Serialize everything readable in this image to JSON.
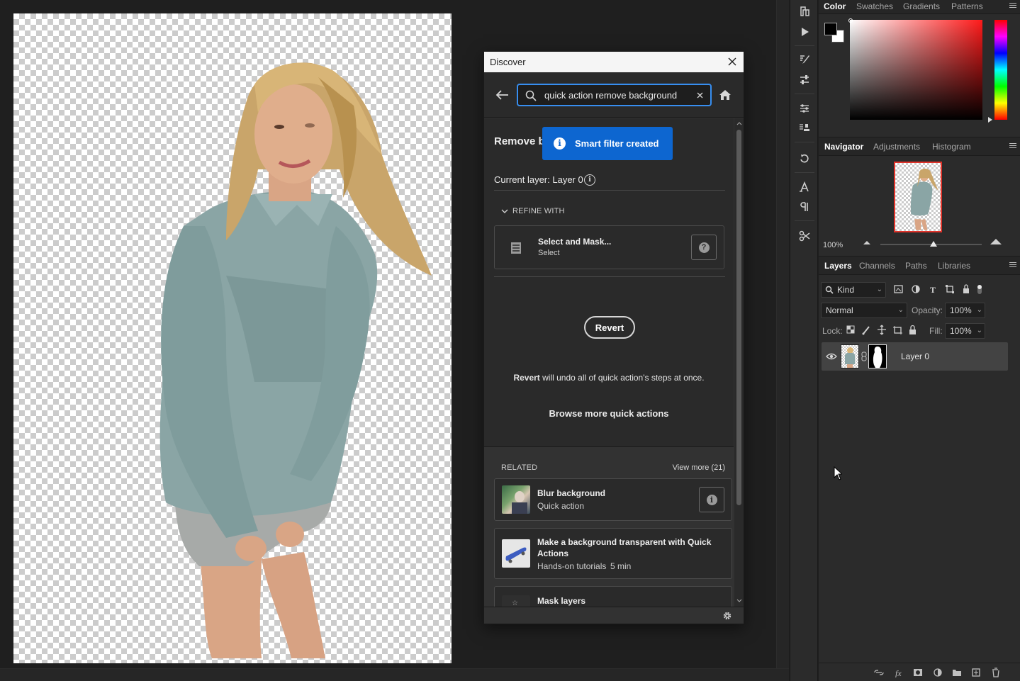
{
  "color_panel": {
    "tabs": [
      "Color",
      "Swatches",
      "Gradients",
      "Patterns"
    ],
    "foreground": "#000000",
    "background": "#ffffff"
  },
  "navigator": {
    "tabs": [
      "Navigator",
      "Adjustments",
      "Histogram"
    ],
    "zoom": "100%"
  },
  "layers": {
    "tabs": [
      "Layers",
      "Channels",
      "Paths",
      "Libraries"
    ],
    "filter_kind": "Kind",
    "blend_mode": "Normal",
    "opacity_label": "Opacity:",
    "opacity_value": "100%",
    "lock_label": "Lock:",
    "fill_label": "Fill:",
    "fill_value": "100%",
    "items": [
      {
        "name": "Layer 0",
        "visible": true
      }
    ]
  },
  "discover": {
    "title": "Discover",
    "search_value": "quick action remove background",
    "heading": "Remove b",
    "toast": "Smart filter created",
    "current_layer": "Current layer: Layer 0",
    "refine_heading": "REFINE WITH",
    "refine_item": {
      "title": "Select and Mask...",
      "subtitle": "Select"
    },
    "revert_label": "Revert",
    "revert_note_bold": "Revert",
    "revert_note_rest": " will undo all of quick action's steps at once.",
    "browse_more": "Browse more quick actions",
    "related_heading": "RELATED",
    "view_more": "View more (21)",
    "related": [
      {
        "title": "Blur background",
        "subtitle": "Quick action"
      },
      {
        "title": "Make a background transparent with Quick Actions",
        "subtitle": "Hands-on tutorials",
        "duration": "5 min"
      },
      {
        "title": "Mask layers"
      }
    ]
  },
  "colors": {
    "accent_blue": "#0d66d0",
    "focus_blue": "#378ef0",
    "nav_frame_red": "#e0332a"
  }
}
